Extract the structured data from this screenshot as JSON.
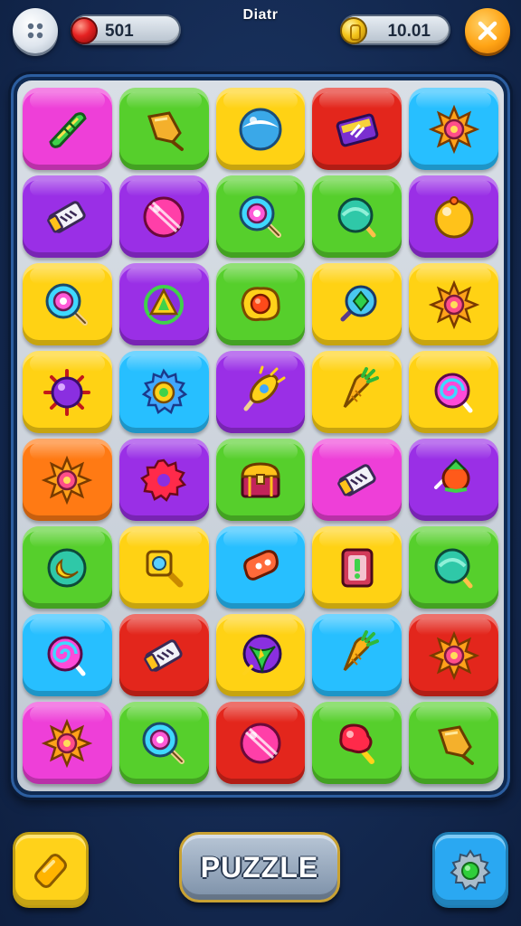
{
  "hud": {
    "title": "Diatr",
    "lives": "501",
    "coins": "10.01",
    "menu_icon": "menu-dots-icon",
    "close_icon": "close-icon"
  },
  "colors": {
    "pink": "#ee3fd8",
    "green": "#56cf2c",
    "yellow": "#ffd214",
    "red": "#e3261c",
    "cyan": "#27bfff",
    "purple": "#9a2fe6",
    "orange": "#ff7a14"
  },
  "board": {
    "rows": [
      [
        {
          "color": "pink",
          "icon": "leaf-tag"
        },
        {
          "color": "green",
          "icon": "gem-arrow"
        },
        {
          "color": "yellow",
          "icon": "pearl-ball"
        },
        {
          "color": "red",
          "icon": "candy-box"
        },
        {
          "color": "cyan",
          "icon": "sun-flower"
        }
      ],
      [
        {
          "color": "purple",
          "icon": "candy-bar"
        },
        {
          "color": "purple",
          "icon": "striped-ball"
        },
        {
          "color": "green",
          "icon": "lollipop"
        },
        {
          "color": "green",
          "icon": "round-candy"
        },
        {
          "color": "purple",
          "icon": "orange-ball"
        }
      ],
      [
        {
          "color": "yellow",
          "icon": "lollipop"
        },
        {
          "color": "purple",
          "icon": "triangle-gem"
        },
        {
          "color": "green",
          "icon": "orange-blob"
        },
        {
          "color": "yellow",
          "icon": "gem-wand"
        },
        {
          "color": "yellow",
          "icon": "sun-flower"
        }
      ],
      [
        {
          "color": "yellow",
          "icon": "spiky-ball"
        },
        {
          "color": "cyan",
          "icon": "gear-ring"
        },
        {
          "color": "purple",
          "icon": "rocket-candy"
        },
        {
          "color": "yellow",
          "icon": "carrot-candy"
        },
        {
          "color": "yellow",
          "icon": "swirl-pop"
        }
      ],
      [
        {
          "color": "orange",
          "icon": "sun-flower"
        },
        {
          "color": "purple",
          "icon": "red-gear"
        },
        {
          "color": "green",
          "icon": "treasure-chest"
        },
        {
          "color": "pink",
          "icon": "candy-bar"
        },
        {
          "color": "purple",
          "icon": "turtle-candy"
        }
      ],
      [
        {
          "color": "green",
          "icon": "moon-orb"
        },
        {
          "color": "yellow",
          "icon": "magnifier"
        },
        {
          "color": "cyan",
          "icon": "gummy-bear"
        },
        {
          "color": "yellow",
          "icon": "block-candy"
        },
        {
          "color": "green",
          "icon": "round-candy"
        }
      ],
      [
        {
          "color": "cyan",
          "icon": "swirl-pop"
        },
        {
          "color": "red",
          "icon": "candy-bar"
        },
        {
          "color": "yellow",
          "icon": "star-orb"
        },
        {
          "color": "cyan",
          "icon": "carrot-candy"
        },
        {
          "color": "red",
          "icon": "sun-flower"
        }
      ],
      [
        {
          "color": "pink",
          "icon": "sun-flower"
        },
        {
          "color": "green",
          "icon": "lollipop"
        },
        {
          "color": "red",
          "icon": "striped-ball"
        },
        {
          "color": "green",
          "icon": "ice-cream"
        },
        {
          "color": "green",
          "icon": "gem-arrow"
        }
      ]
    ]
  },
  "bottom": {
    "puzzle_label": "PUZZLE",
    "left_icon": "candy-icon",
    "right_icon": "settings-gear-icon"
  }
}
